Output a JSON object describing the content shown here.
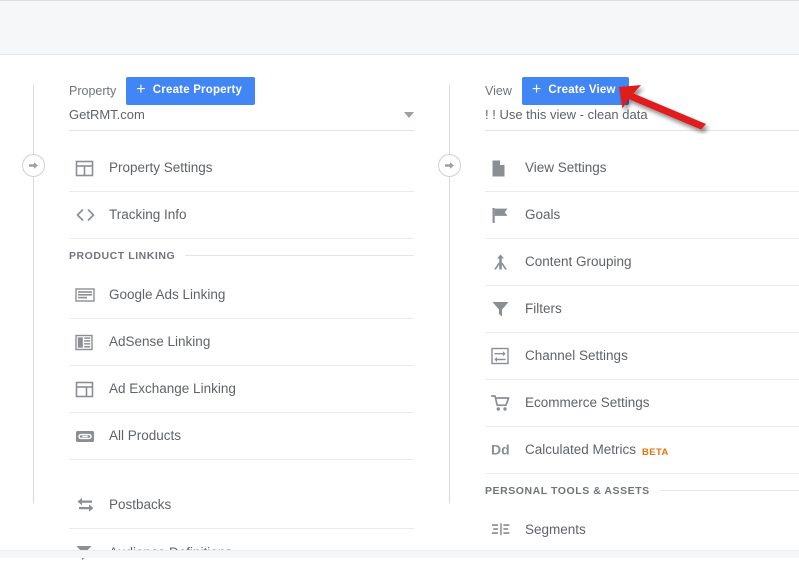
{
  "window": {
    "app": "Google Analytics Admin"
  },
  "colors": {
    "accent_blue": "#4285f4",
    "beta_orange": "#e8710a",
    "text_gray": "#5f6368",
    "annotation_red": "#e01b1b",
    "topbar_gray": "#f6f7f8"
  },
  "property_column": {
    "label": "Property",
    "create_button": "Create Property",
    "selector_value": "GetRMT.com",
    "rail_icon": "arrow-right-circle-icon",
    "items": [
      {
        "type": "item",
        "label": "Property Settings",
        "icon": "property-settings-icon"
      },
      {
        "type": "item",
        "label": "Tracking Info",
        "icon": "code-brackets-icon"
      },
      {
        "type": "section",
        "label": "PRODUCT LINKING"
      },
      {
        "type": "item",
        "label": "Google Ads Linking",
        "icon": "google-ads-icon"
      },
      {
        "type": "item",
        "label": "AdSense Linking",
        "icon": "adsense-icon"
      },
      {
        "type": "item",
        "label": "Ad Exchange Linking",
        "icon": "ad-exchange-icon"
      },
      {
        "type": "item",
        "label": "All Products",
        "icon": "all-products-link-icon"
      },
      {
        "type": "gap"
      },
      {
        "type": "item",
        "label": "Postbacks",
        "icon": "postbacks-icon"
      },
      {
        "type": "item",
        "label": "Audience Definitions",
        "icon": "audience-definitions-icon"
      }
    ]
  },
  "view_column": {
    "label": "View",
    "create_button": "Create View",
    "selector_value": "! ! Use this view - clean data",
    "rail_icon": "arrow-right-circle-icon",
    "items": [
      {
        "type": "item",
        "label": "View Settings",
        "icon": "document-icon"
      },
      {
        "type": "item",
        "label": "Goals",
        "icon": "flag-icon"
      },
      {
        "type": "item",
        "label": "Content Grouping",
        "icon": "content-grouping-icon"
      },
      {
        "type": "item",
        "label": "Filters",
        "icon": "funnel-icon"
      },
      {
        "type": "item",
        "label": "Channel Settings",
        "icon": "channel-settings-icon"
      },
      {
        "type": "item",
        "label": "Ecommerce Settings",
        "icon": "shopping-cart-icon"
      },
      {
        "type": "item",
        "label": "Calculated Metrics",
        "icon": "dd-metrics-icon",
        "badge": "BETA"
      },
      {
        "type": "section",
        "label": "PERSONAL TOOLS & ASSETS"
      },
      {
        "type": "item",
        "label": "Segments",
        "icon": "segments-icon"
      }
    ]
  },
  "annotation": {
    "name": "red-arrow-pointing-at-create-view",
    "points_to": "Create View"
  }
}
